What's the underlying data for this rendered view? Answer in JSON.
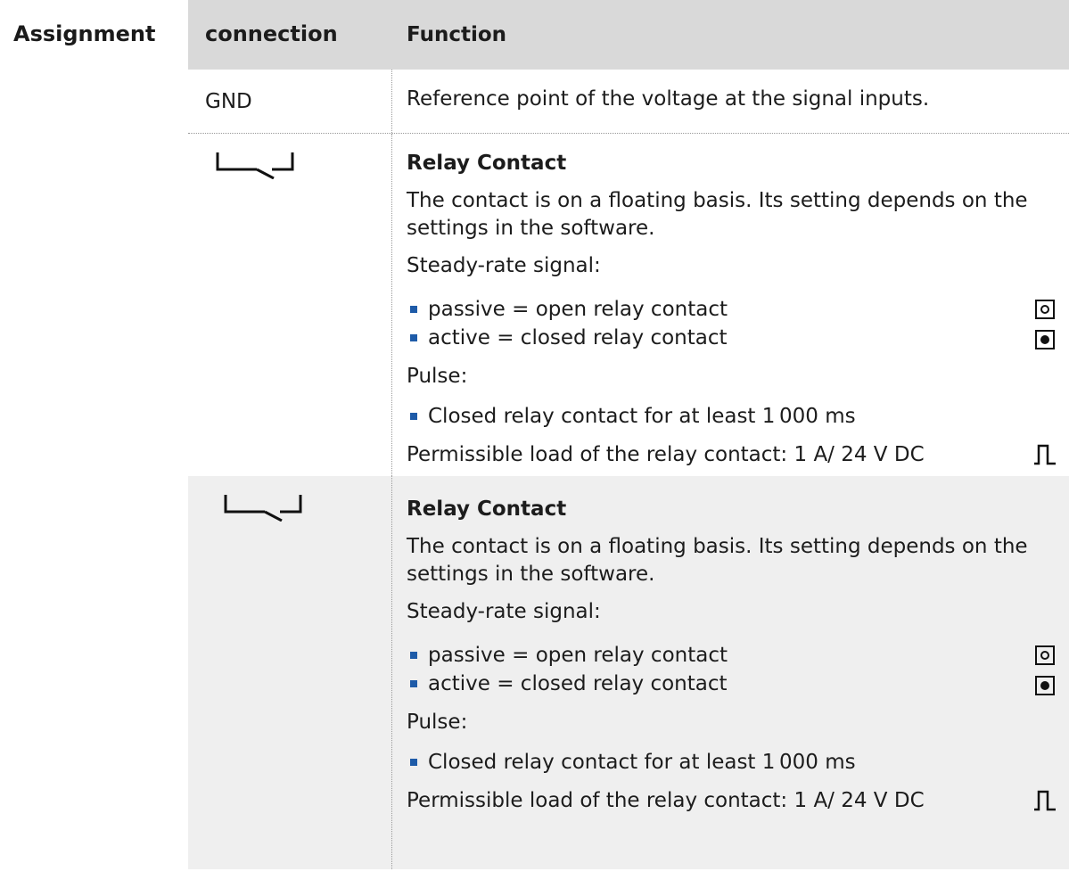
{
  "side_label": "Assignment",
  "table": {
    "header": {
      "connection": "connection",
      "function": "Function"
    },
    "gnd_row": {
      "connection": "GND",
      "function": "Reference point of the voltage at the signal inputs."
    },
    "relay_rows": [
      {
        "connection_icon": "relay-contact-icon",
        "title": "Relay Contact",
        "description": "The contact is on a floating basis. Its setting depends on the settings in the software.",
        "steady_label": "Steady-rate signal:",
        "steady_items": [
          "passive = open relay contact",
          "active = closed relay contact"
        ],
        "pulse_label": "Pulse:",
        "pulse_items": [
          "Closed relay contact for at least 1 000 ms"
        ],
        "load_text": "Permissible load of the relay contact: 1 A/ 24 V DC",
        "indicator_icons": [
          "open-contact-icon",
          "closed-contact-icon",
          "pulse-signal-icon"
        ]
      },
      {
        "connection_icon": "relay-contact-icon",
        "title": "Relay Contact",
        "description": "The contact is on a floating basis. Its setting depends on the settings in the software.",
        "steady_label": "Steady-rate signal:",
        "steady_items": [
          "passive = open relay contact",
          "active = closed relay contact"
        ],
        "pulse_label": "Pulse:",
        "pulse_items": [
          "Closed relay contact for at least 1 000 ms"
        ],
        "load_text": "Permissible load of the relay contact: 1 A/ 24 V DC",
        "indicator_icons": [
          "open-contact-icon",
          "closed-contact-icon",
          "pulse-signal-icon"
        ]
      }
    ]
  },
  "colors": {
    "header_bg": "#d9d9d9",
    "shaded_row_bg": "#efefef",
    "bullet": "#1e5ba8"
  }
}
